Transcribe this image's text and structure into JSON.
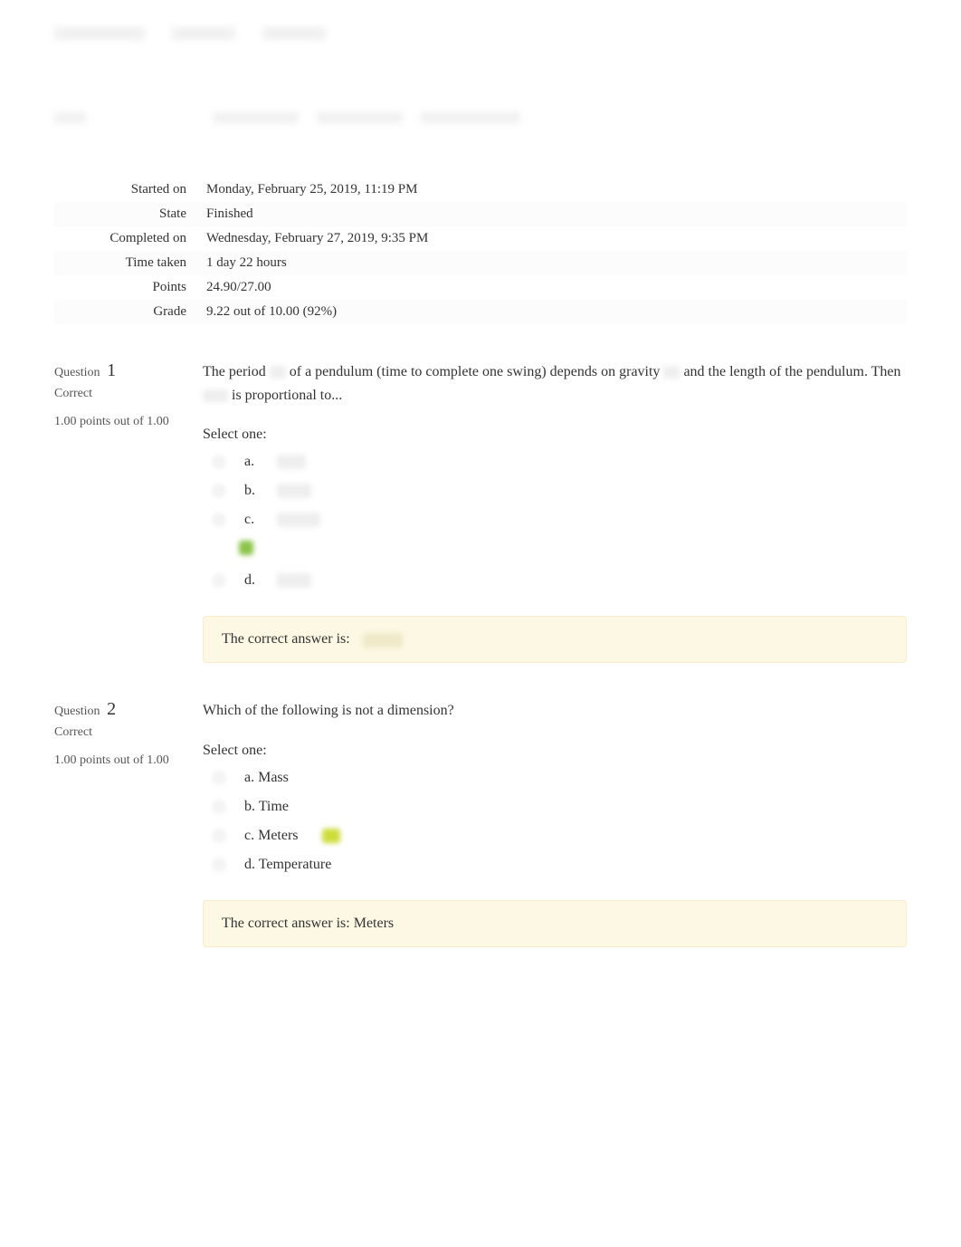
{
  "summary": {
    "started_on_label": "Started on",
    "started_on_value": "Monday, February 25, 2019, 11:19 PM",
    "state_label": "State",
    "state_value": "Finished",
    "completed_on_label": "Completed on",
    "completed_on_value": "Wednesday, February 27, 2019, 9:35 PM",
    "time_taken_label": "Time taken",
    "time_taken_value": "1 day 22 hours",
    "points_label": "Points",
    "points_value": "24.90/27.00",
    "grade_label": "Grade",
    "grade_value_prefix": "9.22",
    "grade_value_mid": " out of 10.00 (",
    "grade_value_pct": "92",
    "grade_value_suffix": "%)"
  },
  "q1": {
    "label": "Question",
    "number": "1",
    "status": "Correct",
    "points": "1.00 points out of 1.00",
    "text_part1": "The period ",
    "text_part2": " of a pendulum (time to complete one swing) depends on gravity ",
    "text_part3": " and the length of the pendulum. Then ",
    "text_part4": " is proportional to...",
    "select_one": "Select one:",
    "opt_a": "a.",
    "opt_b": "b.",
    "opt_c": "c.",
    "opt_d": "d.",
    "feedback": "The correct answer is:"
  },
  "q2": {
    "label": "Question",
    "number": "2",
    "status": "Correct",
    "points": "1.00 points out of 1.00",
    "text": "Which of the following is not a dimension?",
    "select_one": "Select one:",
    "opt_a": "a. Mass",
    "opt_b": "b. Time",
    "opt_c": "c. Meters",
    "opt_d": "d. Temperature",
    "feedback": "The correct answer is: Meters"
  }
}
